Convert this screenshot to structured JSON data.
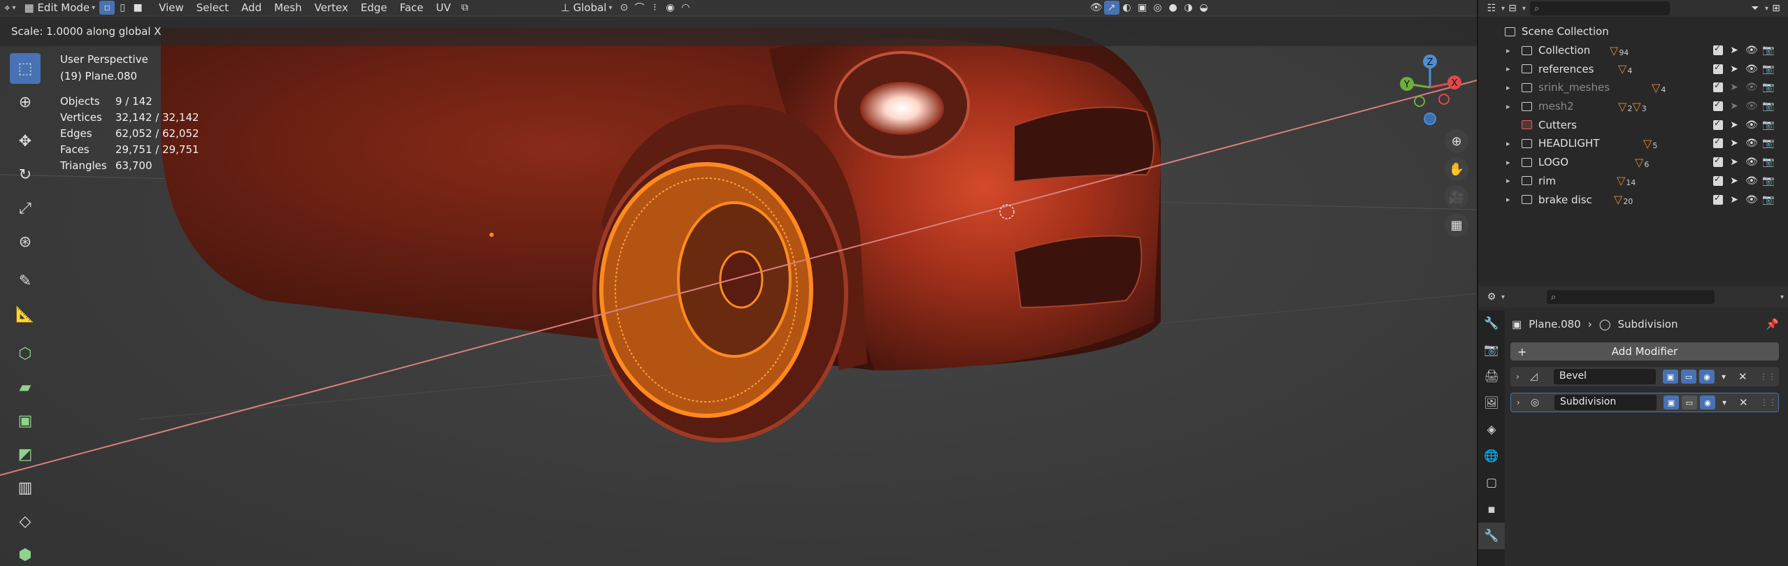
{
  "header": {
    "editor_type_icon": "3d-viewport-icon",
    "mode_label": "Edit Mode",
    "menus": [
      "View",
      "Select",
      "Add",
      "Mesh",
      "Vertex",
      "Edge",
      "Face",
      "UV"
    ],
    "orientation_label": "Global"
  },
  "operator_status": "Scale: 1.0000 along global X",
  "viewport_info": {
    "view_name": "User Perspective",
    "object_name": "(19) Plane.080",
    "stats": [
      {
        "label": "Objects",
        "value": "9 / 142"
      },
      {
        "label": "Vertices",
        "value": "32,142 / 32,142"
      },
      {
        "label": "Edges",
        "value": "62,052 / 62,052"
      },
      {
        "label": "Faces",
        "value": "29,751 / 29,751"
      },
      {
        "label": "Triangles",
        "value": "63,700"
      }
    ]
  },
  "gizmo": {
    "z": "Z",
    "y": "Y",
    "x": "X"
  },
  "outliner": {
    "root": "Scene Collection",
    "items": [
      {
        "name": "Collection",
        "count": "94",
        "dim": false
      },
      {
        "name": "references",
        "count": "4",
        "dim": false
      },
      {
        "name": "srink_meshes",
        "count": "4",
        "dim": true
      },
      {
        "name": "mesh2",
        "count": "2",
        "count2": "3",
        "dim": true
      },
      {
        "name": "Cutters",
        "count": "",
        "dim": false
      },
      {
        "name": "HEADLIGHT",
        "count": "5",
        "dim": false
      },
      {
        "name": "LOGO",
        "count": "6",
        "dim": false
      },
      {
        "name": "rim",
        "count": "14",
        "dim": false
      },
      {
        "name": "brake disc",
        "count": "20",
        "dim": false
      }
    ]
  },
  "properties": {
    "object_name": "Plane.080",
    "modifier_context": "Subdivision",
    "add_modifier_label": "Add Modifier",
    "modifiers": [
      {
        "name": "Bevel",
        "selected": false
      },
      {
        "name": "Subdivision",
        "selected": true
      }
    ]
  },
  "colors": {
    "accent": "#4772b3",
    "selection_orange": "#ff8a1f",
    "car_paint": "#b5371f"
  }
}
